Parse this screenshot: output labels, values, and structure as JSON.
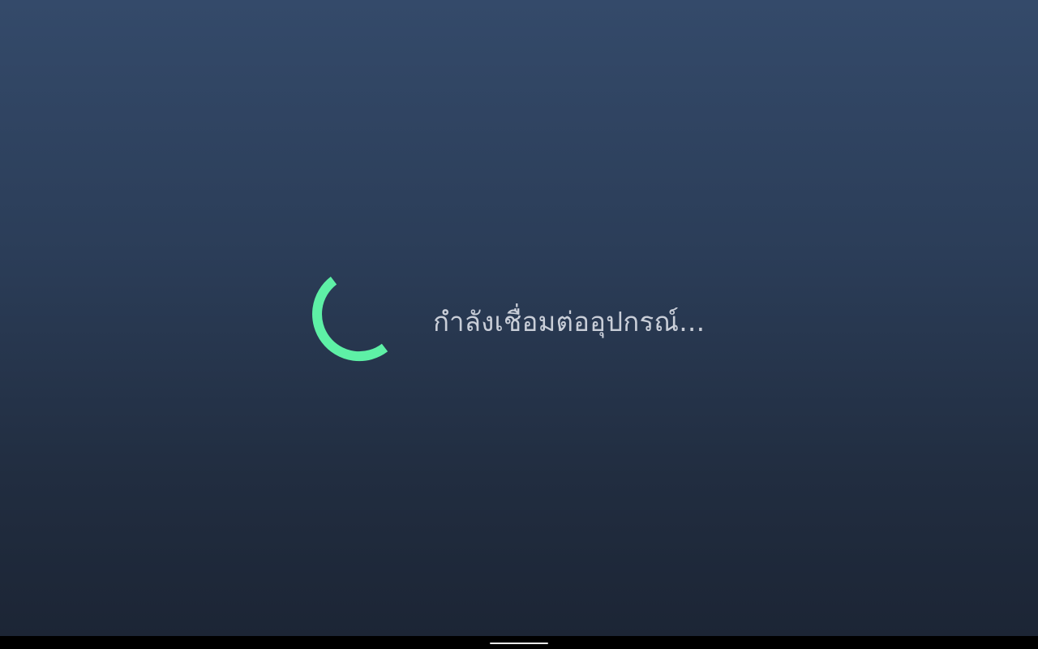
{
  "loading": {
    "message": "กำลังเชื่อมต่ออุปกรณ์...",
    "spinner_icon": "loading-spinner-icon",
    "spinner_color": "#5ef0a6",
    "text_color": "#c9ced8"
  },
  "system_nav": {
    "home_indicator_icon": "home-gesture-handle"
  },
  "colors": {
    "background_top": "#344a6a",
    "background_bottom": "#1c2535",
    "nav_bar": "#000000"
  }
}
